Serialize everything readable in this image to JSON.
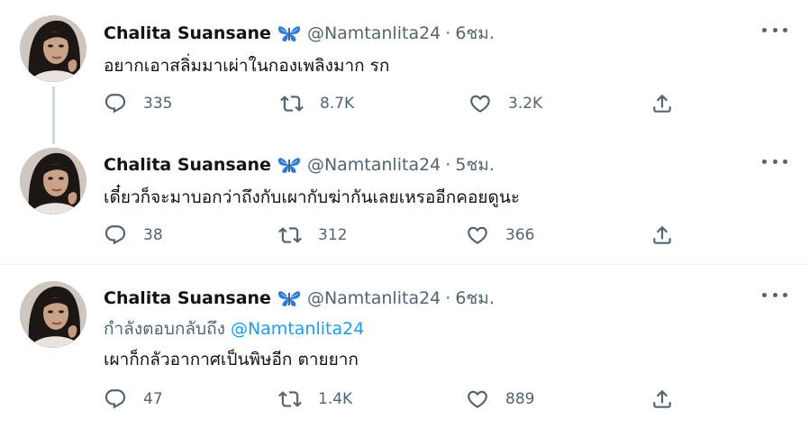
{
  "tweets": [
    {
      "name": "Chalita Suansane",
      "handle": "@Namtanlita24",
      "dot": "·",
      "time": "6ชม.",
      "text": "อยากเอาสลิ่มมาเผ่าในกองเพลิงมาก รก",
      "replies": "335",
      "retweets": "8.7K",
      "likes": "3.2K"
    },
    {
      "name": "Chalita Suansane",
      "handle": "@Namtanlita24",
      "dot": "·",
      "time": "5ชม.",
      "text": "เดี๋ยวก็จะมาบอกว่าถึงกับเผากับฆ่ากันเลยเหรออีกคอยดูนะ",
      "replies": "38",
      "retweets": "312",
      "likes": "366"
    },
    {
      "name": "Chalita Suansane",
      "handle": "@Namtanlita24",
      "dot": "·",
      "time": "6ชม.",
      "replying_prefix": "กำลังตอบกลับถึง",
      "replying_to": "@Namtanlita24",
      "text": "เผาก็กลัวอากาศเป็นพิษอีก ตายยาก",
      "replies": "47",
      "retweets": "1.4K",
      "likes": "889"
    }
  ],
  "icons": {
    "verified": "butterfly-badge-icon",
    "reply": "reply-icon",
    "retweet": "retweet-icon",
    "like": "heart-icon",
    "share": "share-icon",
    "more": "more-icon"
  },
  "colors": {
    "text": "#0f1419",
    "secondary": "#536471",
    "accent": "#1d9bf0",
    "thread_line": "#cfd9de",
    "divider": "#eff3f4"
  }
}
